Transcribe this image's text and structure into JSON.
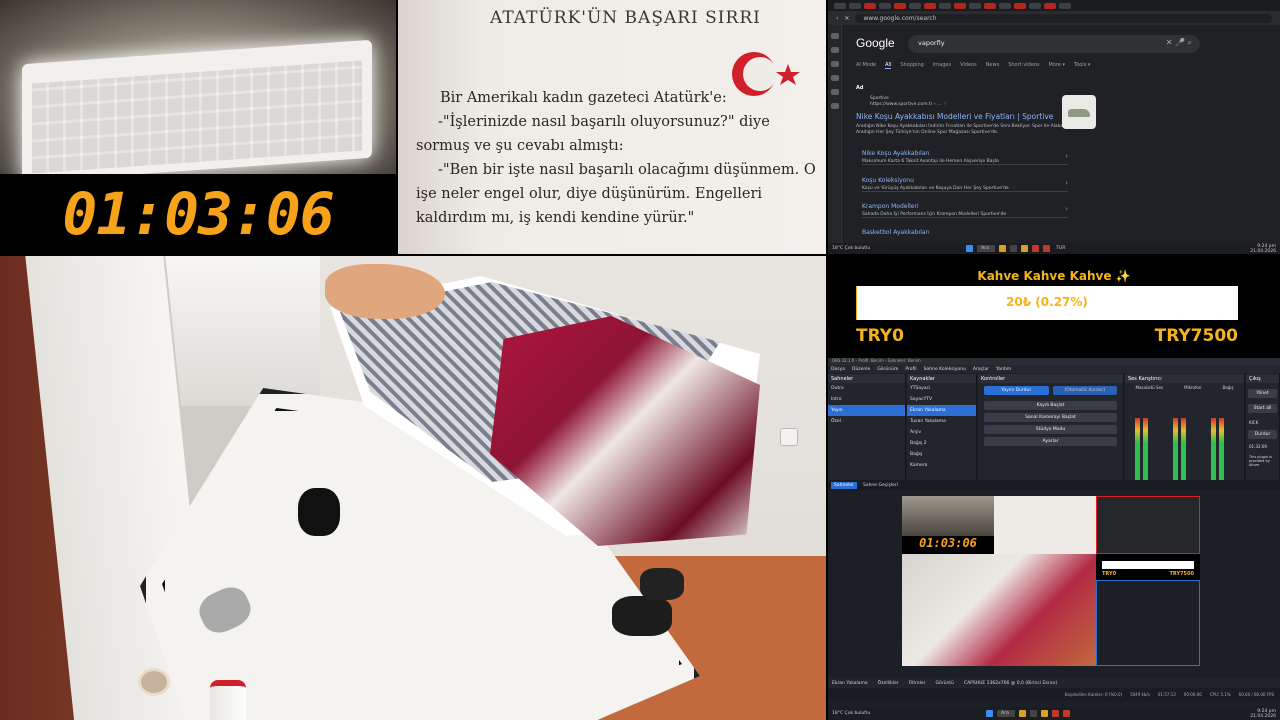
{
  "timer": {
    "value": "01:03:06"
  },
  "book": {
    "title": "ATATÜRK'ÜN BAŞARI SIRRI",
    "p1": "Bir Amerikalı kadın gazeteci Atatürk'e:",
    "p2": "-\"İşlerinizde nasıl başarılı oluyorsunuz?\" diye sormuş ve şu cevabı almıştı:",
    "p3": "-\"Ben bir işte nasıl başarılı olacağımı düşünmem. O işe neler engel olur, diye düşünürüm. Engelleri kaldırdım mı, iş kendi kendine yürür.\""
  },
  "browser": {
    "url": "www.google.com/search",
    "logo": "Google",
    "query": "vaporfly",
    "nav": [
      "AI Mode",
      "All",
      "Shopping",
      "Images",
      "Videos",
      "News",
      "Short videos",
      "More ▾",
      "Tools ▾"
    ],
    "ad_label": "Ad",
    "site_name": "Sportive",
    "site_url": "https://www.sportive.com.tr › ... ⋮",
    "headline": "Nike Koşu Ayakkabısı Modelleri ve Fiyatları | Sportive",
    "description": "Aradığın Nike Koşu Ayakkabıları İndirim Fırsatları ile Sportive'de Seni Bekliyor. Spor ile Alakalı Aradığın Her Şey Türkiye'nin Online Spor Mağazası Sportive'de.",
    "links": [
      {
        "title": "Nike Koşu Ayakkabıları",
        "desc": "Maksimum Karta 6 Taksit Avantajı ile Hemen Alışverişe Başla"
      },
      {
        "title": "Koşu Koleksiyonu",
        "desc": "Koşu ve Yürüyüş Ayakkabıları ve Koşuya Dair Her Şey Sportive'de"
      },
      {
        "title": "Krampon Modelleri",
        "desc": "Sahada Daha İyi Performans İçin Krampon Modelleri Sportive'de"
      },
      {
        "title": "Basketbol Ayakkabıları",
        "desc": ""
      }
    ],
    "taskbar": {
      "weather": "18°C",
      "weather_sub": "Çok bulutlu",
      "search": "Ara",
      "lang": "TUR",
      "time": "9:24 pm",
      "date": "21.04.2026"
    }
  },
  "donation": {
    "title": "Kahve Kahve Kahve ✨",
    "progress_text": "20₺ (0.27%)",
    "progress_fraction": 0.0027,
    "min_label": "TRY0",
    "max_label": "TRY7500"
  },
  "obs": {
    "title": "OBS 32.1.0 - Profil: Benim - Sahneler: Benim",
    "menu": [
      "Dosya",
      "Düzenle",
      "Görünüm",
      "Profil",
      "Sahne Koleksiyonu",
      "Araçlar",
      "Yardım"
    ],
    "scenes_title": "Sahneler",
    "scenes": [
      "Outro",
      "Intro",
      "Yayın",
      "Özel"
    ],
    "sources_title": "Kaynaklar",
    "sources": [
      "YTSayaci",
      "SayacYTV",
      "Ekran Yakalama",
      "Tuvan Yakalama",
      "Arşiv",
      "Bağış 2",
      "Bağış",
      "Kamera"
    ],
    "controls_title": "Kontroller",
    "controls": [
      "Yayını Durdur",
      "(Otomatik durdur)",
      "Kaydı Başlat",
      "Sanal Kamerayı Başlat",
      "Stüdyo Modu",
      "Ayarlar"
    ],
    "mixer_title": "Ses Karıştırıcı",
    "mixer_channels": [
      "Masaüstü Ses",
      "Mikrofon",
      "Bağış"
    ],
    "right_title": "Çıkış",
    "right_items": [
      "Yönet",
      "Start all",
      "KICK",
      "Durdur",
      "01:32:09",
      "This plugin is provided by Aitum"
    ],
    "tabs": [
      "Sahneler",
      "Sahne Geçişleri"
    ],
    "status_items": [
      "Ekran Yakalama",
      "Özellikler",
      "Filtreler",
      "Görüntü",
      "CAPSHUE 1362x766 @ 0,0 (Birinci Ekran)"
    ],
    "bottom_items": [
      "Kaydedilen Kareler: 0 (%0.0)",
      "5049 kb/s",
      "01:57:13",
      "00:00:00",
      "CPU: 5.1%",
      "60.00 / 60.00 FPS"
    ],
    "preview_timer": "01:03:06",
    "preview_min": "TRY0",
    "preview_max": "TRY7500",
    "taskbar": {
      "weather": "18°C",
      "weather_sub": "Çok bulutlu",
      "search": "Ara",
      "time": "9:24 pm",
      "date": "21.04.2026"
    }
  }
}
